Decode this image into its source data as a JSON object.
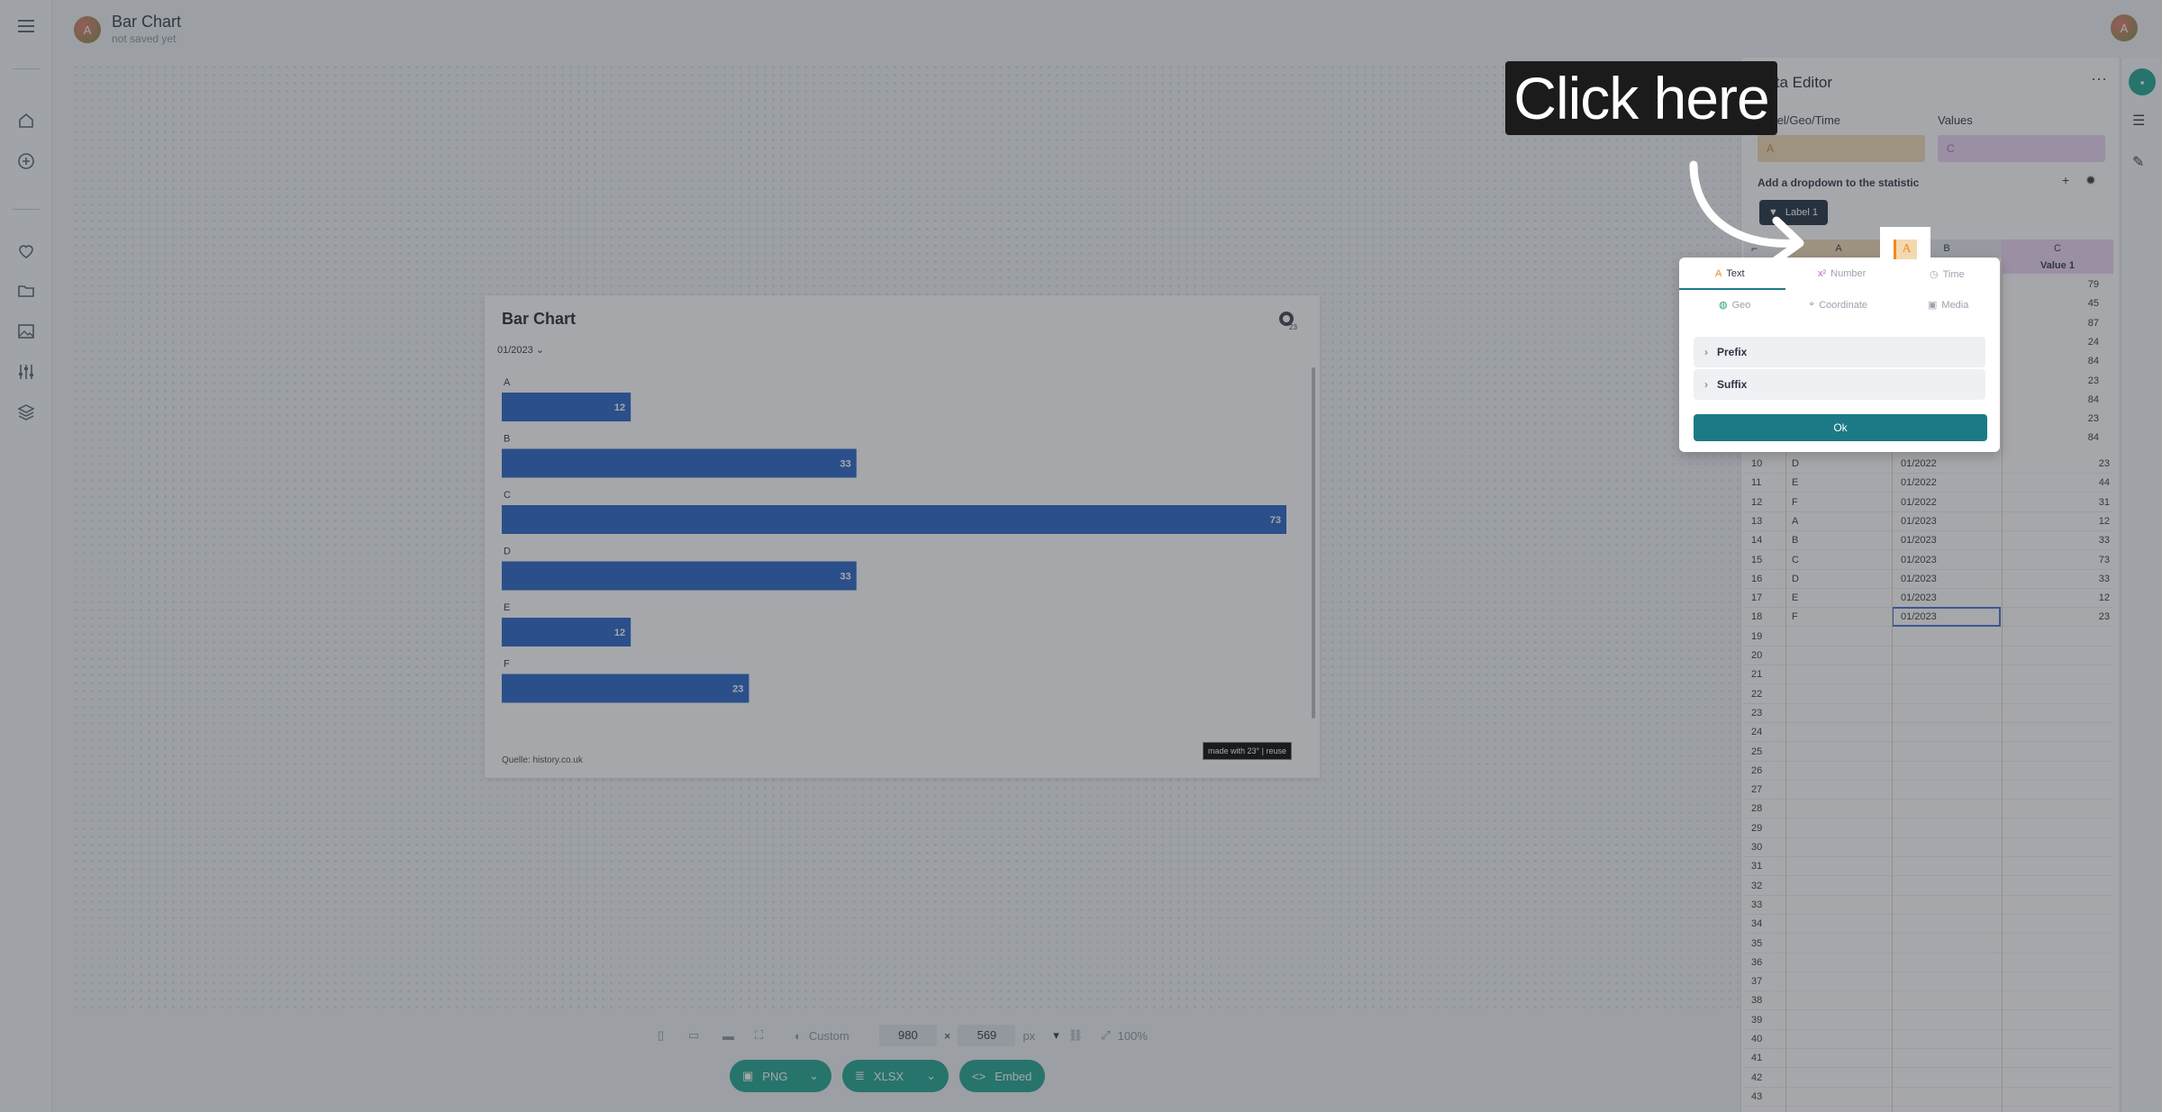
{
  "header": {
    "title": "Bar Chart",
    "subtitle": "not saved yet",
    "avatar_letter": "A",
    "user_avatar_letter": "A"
  },
  "rail": {
    "icons": [
      "menu-icon",
      "home-icon",
      "add-circle-icon",
      "heart-icon",
      "folder-icon",
      "image-icon",
      "sliders-icon",
      "layers-icon"
    ]
  },
  "card": {
    "title": "Bar Chart",
    "filter_value": "01/2023",
    "source": "Quelle: history.co.uk",
    "made_with": "made with 23° | reuse"
  },
  "chart_data": {
    "type": "bar",
    "orientation": "horizontal",
    "categories": [
      "A",
      "B",
      "C",
      "D",
      "E",
      "F"
    ],
    "values": [
      12,
      33,
      73,
      33,
      12,
      23
    ],
    "xlim": [
      0,
      73
    ],
    "bar_color": "#2160c4",
    "data_labels": true,
    "grid": false,
    "legend": "none"
  },
  "toolbar": {
    "size_preset": "Custom",
    "width": "980",
    "x_sign": "×",
    "height": "569",
    "unit": "px",
    "zoom": "100%",
    "png_label": "PNG",
    "xlsx_label": "XLSX",
    "embed_label": "Embed"
  },
  "editor": {
    "title": "Data Editor",
    "role_label_left": "Label/Geo/Time",
    "role_label_right": "Values",
    "role_value_left": "A",
    "role_value_right": "C",
    "dropdown_label": "Add a dropdown to the statistic",
    "filter_chip": "Label 1",
    "columns": {
      "a": "A",
      "b": "B",
      "c": "C",
      "c_header": "Value 1"
    },
    "visible_values_col_c": [
      "79",
      "45",
      "87",
      "24",
      "84",
      "23",
      "84",
      "23",
      "84"
    ],
    "rows": [
      {
        "n": "10",
        "a": "D",
        "b": "01/2022",
        "c": "23"
      },
      {
        "n": "11",
        "a": "E",
        "b": "01/2022",
        "c": "44"
      },
      {
        "n": "12",
        "a": "F",
        "b": "01/2022",
        "c": "31"
      },
      {
        "n": "13",
        "a": "A",
        "b": "01/2023",
        "c": "12"
      },
      {
        "n": "14",
        "a": "B",
        "b": "01/2023",
        "c": "33"
      },
      {
        "n": "15",
        "a": "C",
        "b": "01/2023",
        "c": "73"
      },
      {
        "n": "16",
        "a": "D",
        "b": "01/2023",
        "c": "33"
      },
      {
        "n": "17",
        "a": "E",
        "b": "01/2023",
        "c": "12"
      },
      {
        "n": "18",
        "a": "F",
        "b": "01/2023",
        "c": "23"
      }
    ],
    "empty_rows": [
      "19",
      "20",
      "21",
      "22",
      "23",
      "24",
      "25",
      "26",
      "27",
      "28",
      "29",
      "30",
      "31",
      "32",
      "33",
      "34",
      "35",
      "36",
      "37",
      "38",
      "39",
      "40",
      "41",
      "42",
      "43"
    ]
  },
  "popup": {
    "tabs": [
      "Text",
      "Number",
      "Time"
    ],
    "tabs2": [
      "Geo",
      "Coordinate",
      "Media"
    ],
    "prefix": "Prefix",
    "suffix": "Suffix",
    "ok": "Ok"
  },
  "callout": {
    "text": "Click here"
  },
  "colors": {
    "accent_green": "#1aa38c",
    "teal_button": "#1c7a86",
    "label_col": "#f3d9b2",
    "value_col": "#edd4f3"
  }
}
